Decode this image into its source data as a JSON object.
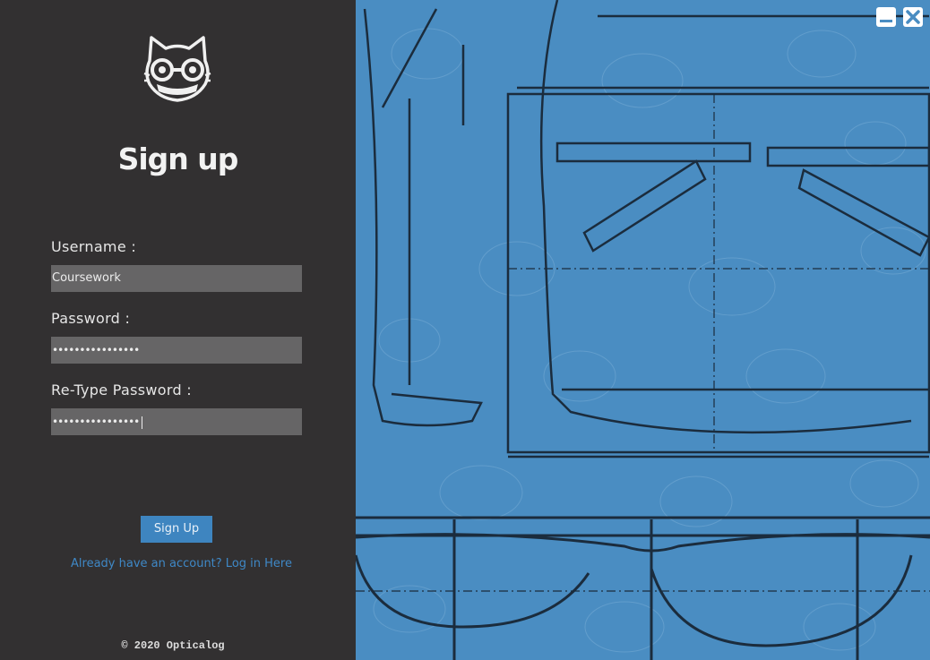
{
  "form": {
    "title": "Sign up",
    "username_label": "Username :",
    "username_value": "Coursework",
    "password_label": "Password :",
    "password_value": "••••••••••••••••",
    "retype_label": "Re-Type Password :",
    "retype_value": "••••••••••••••••",
    "signup_button": "Sign Up",
    "login_link": "Already have an account? Log in Here"
  },
  "footer": {
    "copyright": "© 2020 Opticalog"
  },
  "window": {
    "minimize_icon": "minimize-icon",
    "close_icon": "close-icon"
  },
  "colors": {
    "left_panel": "#323031",
    "right_panel": "#4a8dc2",
    "accent": "#3e85c0",
    "field_bg": "#666566"
  }
}
